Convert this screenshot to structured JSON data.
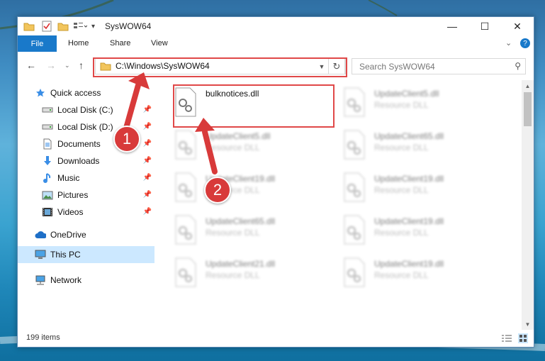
{
  "window": {
    "title": "SysWOW64"
  },
  "ribbon": {
    "tabs": [
      "File",
      "Home",
      "Share",
      "View"
    ]
  },
  "address": {
    "path": "C:\\Windows\\SysWOW64"
  },
  "search": {
    "placeholder": "Search SysWOW64"
  },
  "sidebar": {
    "items": [
      {
        "label": "Quick access",
        "icon": "star-icon"
      },
      {
        "label": "Local Disk (C:)",
        "icon": "drive-icon",
        "pinned": true
      },
      {
        "label": "Local Disk (D:)",
        "icon": "drive-icon",
        "pinned": true
      },
      {
        "label": "Documents",
        "icon": "documents-icon",
        "pinned": true
      },
      {
        "label": "Downloads",
        "icon": "download-icon",
        "pinned": true
      },
      {
        "label": "Music",
        "icon": "music-icon",
        "pinned": true
      },
      {
        "label": "Pictures",
        "icon": "pictures-icon",
        "pinned": true
      },
      {
        "label": "Videos",
        "icon": "videos-icon",
        "pinned": true
      },
      {
        "label": "OneDrive",
        "icon": "cloud-icon"
      },
      {
        "label": "This PC",
        "icon": "computer-icon",
        "selected": true
      },
      {
        "label": "Network",
        "icon": "network-icon"
      }
    ]
  },
  "files": [
    {
      "name": "bulknotices.dll",
      "type": ""
    },
    {
      "name": "UpdateClient5.dll",
      "type": "Resource DLL"
    },
    {
      "name": "UpdateClient5.dll",
      "type": "Resource DLL"
    },
    {
      "name": "UpdateClient65.dll",
      "type": "Resource DLL"
    },
    {
      "name": "UpdateClient19.dll",
      "type": "Resource DLL"
    },
    {
      "name": "UpdateClient19.dll",
      "type": "Resource DLL"
    },
    {
      "name": "UpdateClient65.dll",
      "type": "Resource DLL"
    },
    {
      "name": "UpdateClient19.dll",
      "type": "Resource DLL"
    },
    {
      "name": "UpdateClient21.dll",
      "type": "Resource DLL"
    },
    {
      "name": "UpdateClient19.dll",
      "type": "Resource DLL"
    }
  ],
  "status": {
    "items_count": "199 items"
  },
  "annotations": {
    "step1": "1",
    "step2": "2"
  },
  "colors": {
    "accent": "#1979ca",
    "highlight": "#e04848",
    "selected": "#cce8ff"
  }
}
